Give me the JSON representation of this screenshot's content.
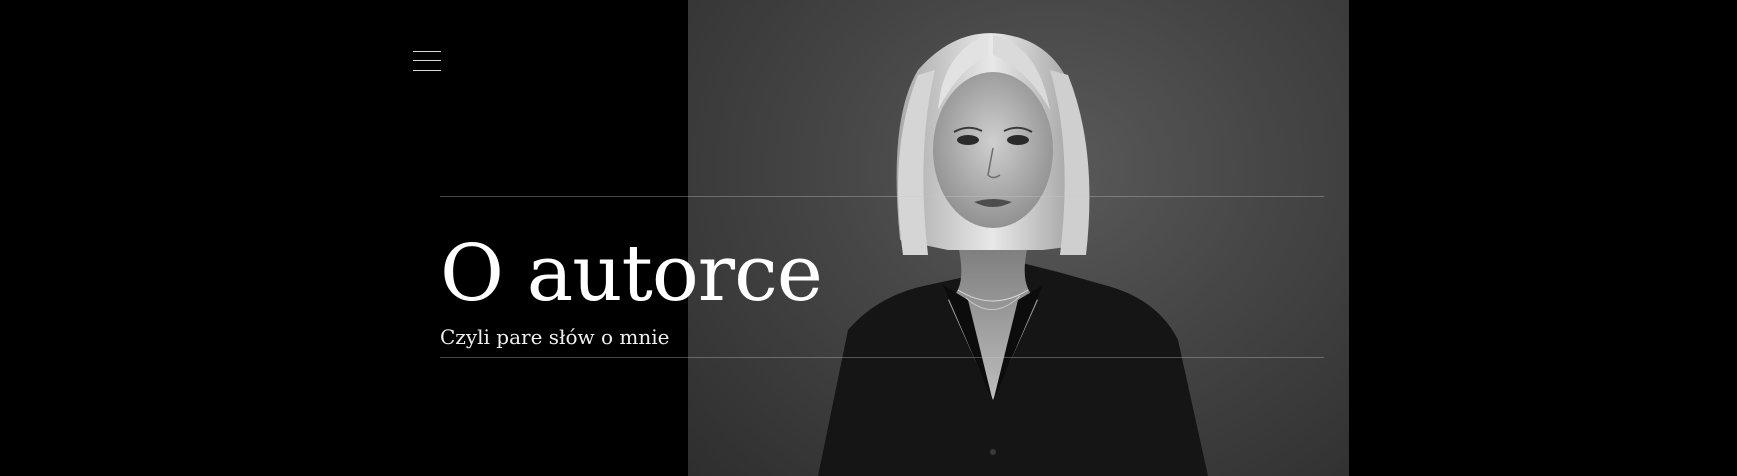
{
  "header": {
    "menu_icon": "hamburger-menu-icon"
  },
  "hero": {
    "title": "O autorce",
    "subtitle": "Czyli pare słów o mnie"
  },
  "colors": {
    "background": "#000000",
    "text": "#ffffff",
    "divider": "#5a5a5a"
  }
}
